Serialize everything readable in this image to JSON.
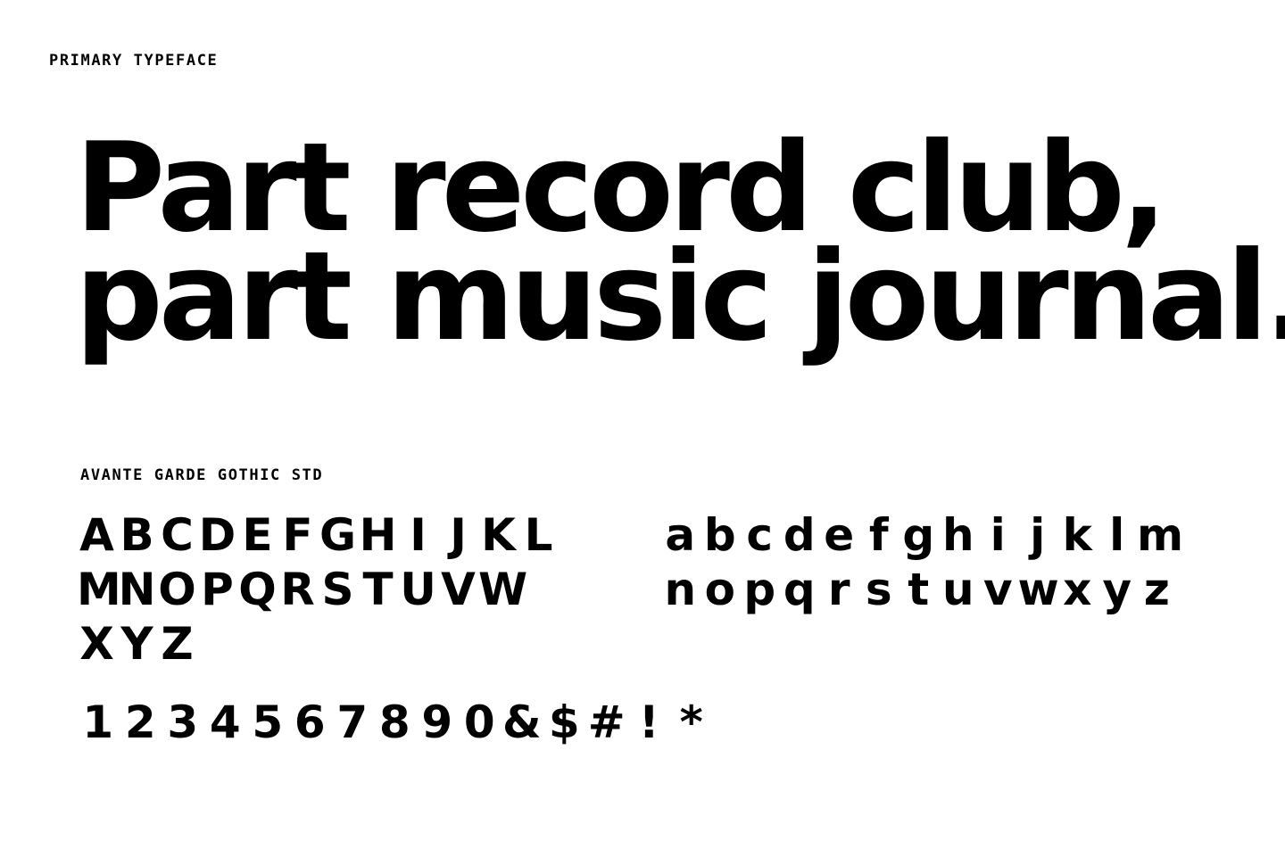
{
  "section_label": "PRIMARY TYPEFACE",
  "headline": {
    "line1": "Part record club,",
    "line2": "part music journal."
  },
  "typeface_name": "AVANTE GARDE GOTHIC STD",
  "glyphs": {
    "uppercase_rows": [
      [
        "A",
        "B",
        "C",
        "D",
        "E",
        "F",
        "G",
        "H",
        "I",
        "J",
        "K",
        "L"
      ],
      [
        "M",
        "N",
        "O",
        "P",
        "Q",
        "R",
        "S",
        "T",
        "U",
        "V",
        "W"
      ],
      [
        "X",
        "Y",
        "Z"
      ]
    ],
    "lowercase_rows": [
      [
        "a",
        "b",
        "c",
        "d",
        "e",
        "f",
        "g",
        "h",
        "i",
        "j",
        "k",
        "l",
        "m"
      ],
      [
        "n",
        "o",
        "p",
        "q",
        "r",
        "s",
        "t",
        "u",
        "v",
        "w",
        "x",
        "y",
        "z"
      ]
    ],
    "numerals_symbols": [
      "1",
      "2",
      "3",
      "4",
      "5",
      "6",
      "7",
      "8",
      "9",
      "0",
      "&",
      "$",
      "#",
      "!",
      "*"
    ]
  }
}
